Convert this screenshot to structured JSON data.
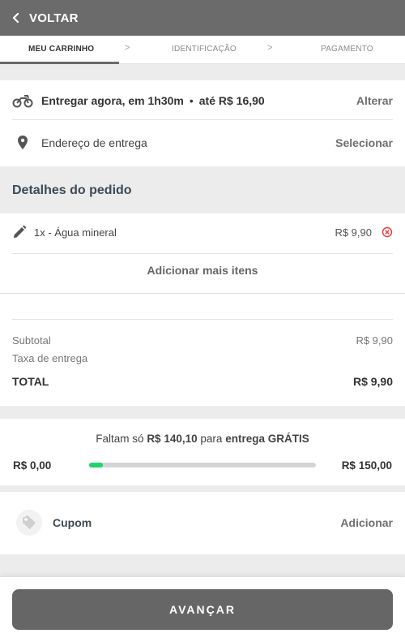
{
  "header": {
    "back_label": "VOLTAR"
  },
  "steps": [
    {
      "label": "MEU CARRINHO"
    },
    {
      "label": "IDENTIFICAÇÃO"
    },
    {
      "label": "PAGAMENTO"
    }
  ],
  "step_separator": ">",
  "delivery": {
    "text": "Entregar agora, em 1h30m",
    "dot": "•",
    "price_text": "até R$ 16,90",
    "change_label": "Alterar"
  },
  "address": {
    "label": "Endereço de entrega",
    "select_label": "Selecionar"
  },
  "details": {
    "title": "Detalhes do pedido"
  },
  "items": [
    {
      "name": "1x - Água mineral",
      "price": "R$ 9,90"
    }
  ],
  "add_more_label": "Adicionar mais itens",
  "summary": {
    "subtotal_label": "Subtotal",
    "subtotal_value": "R$ 9,90",
    "fee_label": "Taxa de entrega",
    "total_label": "TOTAL",
    "total_value": "R$ 9,90"
  },
  "free_shipping": {
    "prefix": "Faltam só",
    "remaining": "R$ 140,10",
    "middle": "para",
    "goal_text": "entrega GRÁTIS",
    "min_label": "R$ 0,00",
    "max_label": "R$ 150,00",
    "progress_percent": 6
  },
  "coupon": {
    "label": "Cupom",
    "add_label": "Adicionar"
  },
  "footer": {
    "advance_label": "AVANÇAR"
  },
  "colors": {
    "header_bg": "#6b6b6b",
    "progress": "#1fd36a",
    "remove_icon": "#e23b3b",
    "button_bg": "#666666"
  }
}
